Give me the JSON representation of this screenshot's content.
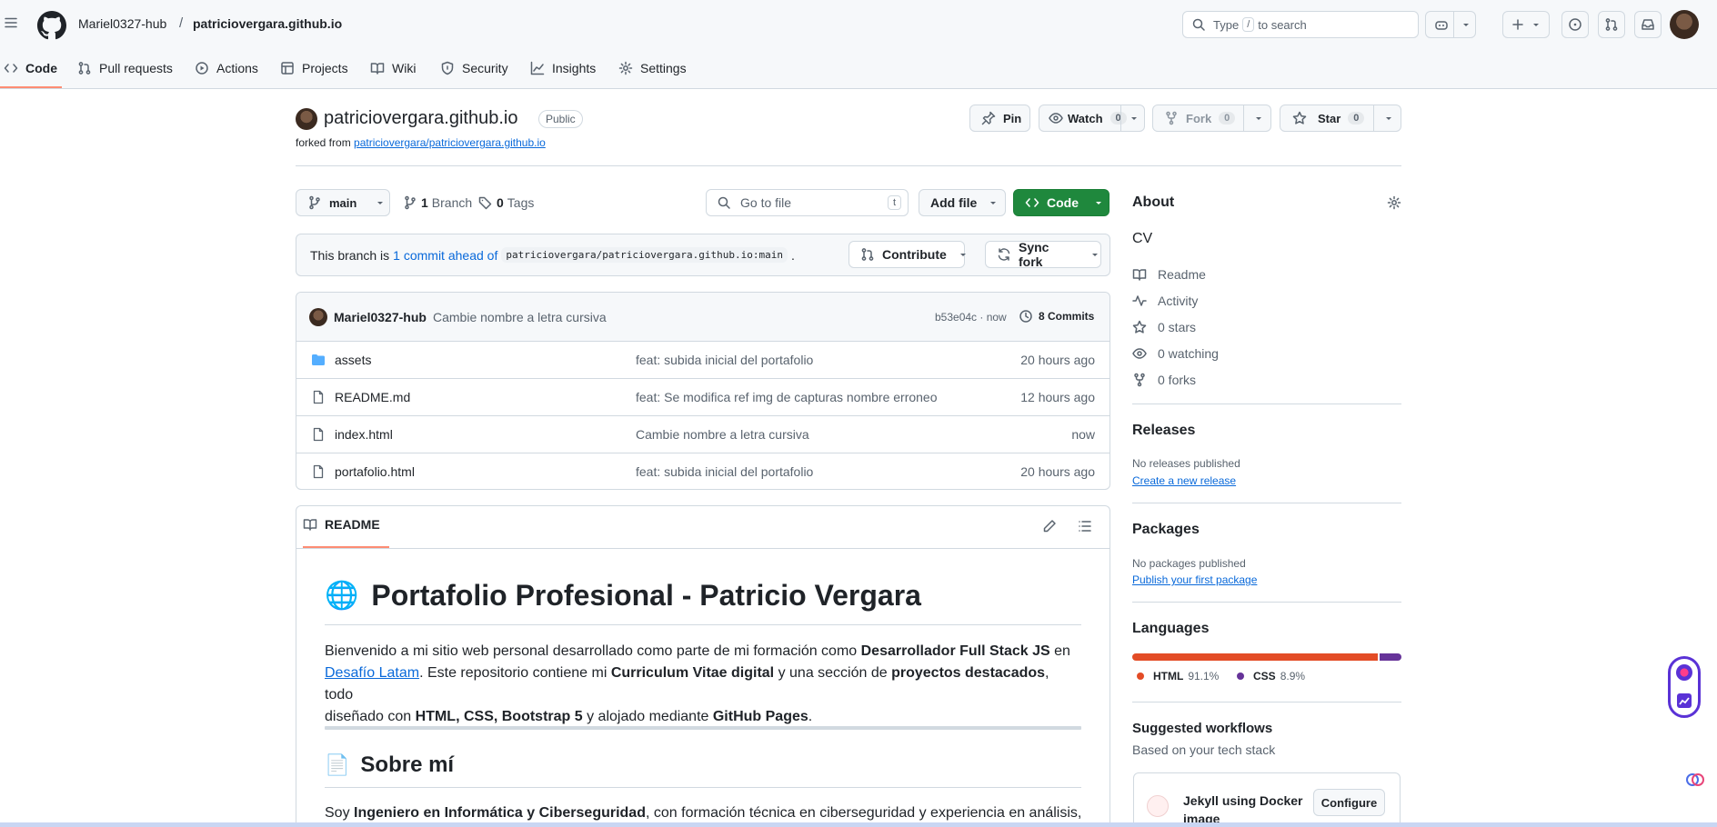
{
  "header": {
    "owner": "Mariel0327-hub",
    "separator": "/",
    "repo": "patriciovergara.github.io",
    "search_prefix": "Type",
    "search_key": "/",
    "search_suffix": "to search"
  },
  "tabs": [
    {
      "label": "Code",
      "icon": "code-icon"
    },
    {
      "label": "Pull requests",
      "icon": "git-pull-request-icon"
    },
    {
      "label": "Actions",
      "icon": "play-icon"
    },
    {
      "label": "Projects",
      "icon": "table-icon"
    },
    {
      "label": "Wiki",
      "icon": "book-icon"
    },
    {
      "label": "Security",
      "icon": "shield-icon"
    },
    {
      "label": "Insights",
      "icon": "graph-icon"
    },
    {
      "label": "Settings",
      "icon": "gear-icon"
    }
  ],
  "repo": {
    "name": "patriciovergara.github.io",
    "visibility": "Public",
    "forked_prefix": "forked from",
    "forked_from": "patriciovergara/patriciovergara.github.io",
    "pin": "Pin",
    "watch": "Watch",
    "watch_count": "0",
    "fork": "Fork",
    "fork_count": "0",
    "star": "Star",
    "star_count": "0"
  },
  "toolbar": {
    "branch": "main",
    "branches_count": "1",
    "branches_label": "Branch",
    "tags_count": "0",
    "tags_label": "Tags",
    "goto_placeholder": "Go to file",
    "goto_key": "t",
    "add_file": "Add file",
    "code": "Code"
  },
  "branch_status": {
    "prefix": "This branch is",
    "ahead": "1 commit ahead of",
    "ref": "patriciovergara/patriciovergara.github.io:main",
    "suffix": ".",
    "contribute": "Contribute",
    "sync": "Sync fork"
  },
  "commit": {
    "author": "Mariel0327-hub",
    "message": "Cambie nombre a letra cursiva",
    "sha_time": "b53e04c · now",
    "commits": "8 Commits"
  },
  "files": [
    {
      "name": "assets",
      "type": "folder",
      "message": "feat: subida inicial del portafolio",
      "time": "20 hours ago"
    },
    {
      "name": "README.md",
      "type": "file",
      "message": "feat: Se modifica ref img de capturas nombre erroneo",
      "time": "12 hours ago"
    },
    {
      "name": "index.html",
      "type": "file",
      "message": "Cambie nombre a letra cursiva",
      "time": "now"
    },
    {
      "name": "portafolio.html",
      "type": "file",
      "message": "feat: subida inicial del portafolio",
      "time": "20 hours ago"
    }
  ],
  "readme": {
    "tab": "README",
    "h1_emoji": "🌐",
    "h1": "Portafolio Profesional - Patricio Vergara",
    "p1": {
      "a": "Bienvenido a mi sitio web personal desarrollado como parte de mi formación como ",
      "b": "Desarrollador Full Stack JS",
      "c": " en",
      "link": "Desafío Latam",
      "d": ". Este repositorio contiene mi ",
      "e": "Curriculum Vitae digital",
      "f": " y una sección de ",
      "g": "proyectos destacados",
      "h": ", todo",
      "i": "diseñado con ",
      "j": "HTML, CSS, Bootstrap 5",
      "k": " y alojado mediante ",
      "l": "GitHub Pages",
      "m": "."
    },
    "h2_emoji": "📄",
    "h2": "Sobre mí",
    "p2": {
      "a": "Soy ",
      "b": "Ingeniero en Informática y Ciberseguridad",
      "c": ", con formación técnica en ciberseguridad y experiencia en análisis,"
    }
  },
  "about": {
    "title": "About",
    "description": "CV",
    "items": [
      {
        "label": "Readme",
        "icon": "book-icon"
      },
      {
        "label": "Activity",
        "icon": "pulse-icon"
      },
      {
        "label": "0 stars",
        "icon": "star-icon"
      },
      {
        "label": "0 watching",
        "icon": "eye-icon"
      },
      {
        "label": "0 forks",
        "icon": "fork-icon"
      }
    ]
  },
  "releases": {
    "title": "Releases",
    "empty": "No releases published",
    "link": "Create a new release"
  },
  "packages": {
    "title": "Packages",
    "empty": "No packages published",
    "link": "Publish your first package"
  },
  "languages": {
    "title": "Languages",
    "items": [
      {
        "name": "HTML",
        "percent": "91.1%",
        "value": 91.1,
        "color": "#e34c26"
      },
      {
        "name": "CSS",
        "percent": "8.9%",
        "value": 8.9,
        "color": "#663399"
      }
    ]
  },
  "workflows": {
    "title": "Suggested workflows",
    "subtitle": "Based on your tech stack",
    "item": "Jekyll using Docker image",
    "configure": "Configure"
  }
}
